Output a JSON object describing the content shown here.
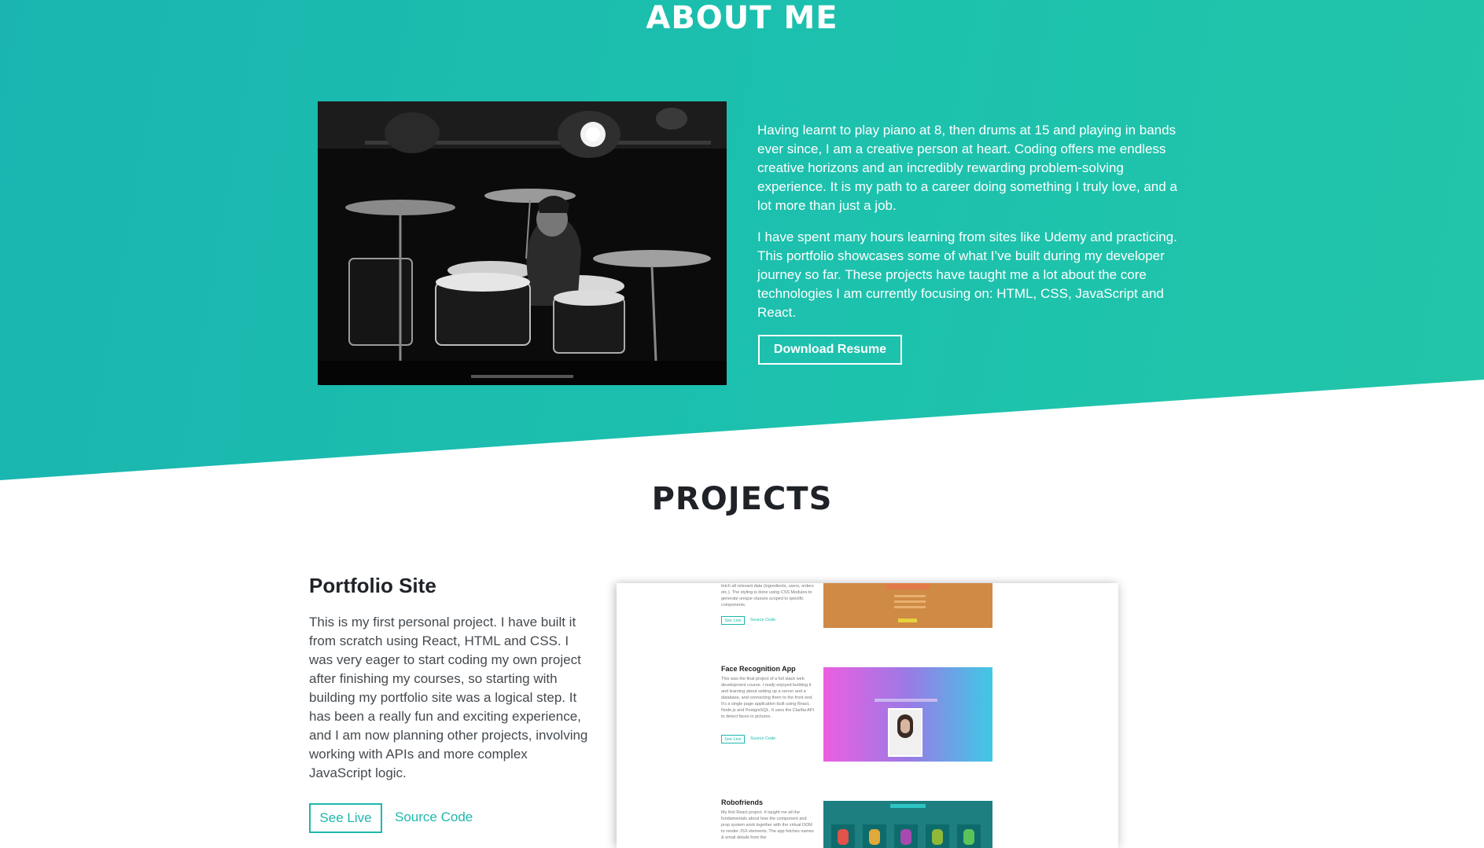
{
  "about": {
    "title": "ABOUT ME",
    "paragraphs": [
      "Having learnt to play piano at 8, then drums at 15 and playing in bands ever since, I am a creative person at heart. Coding offers me endless creative horizons and an incredibly rewarding problem-solving experience. It is my path to a career doing something I truly love, and a lot more than just a job.",
      "I have spent many hours learning from sites like Udemy and practicing. This portfolio showcases some of what I’ve built during my developer journey so far. These projects have taught me a lot about the core technologies I am currently focusing on: HTML, CSS, JavaScript and React."
    ],
    "resume_button": "Download Resume"
  },
  "projects": {
    "title": "PROJECTS",
    "items": [
      {
        "name": "Portfolio Site",
        "description": "This is my first personal project. I have built it from scratch using React, HTML and CSS. I was very eager to start coding my own project after finishing my courses, so starting with building my portfolio site was a logical step. It has been a really fun and exciting experience, and I am now planning other projects, involving working with APIs and more complex JavaScript logic.",
        "see_live": "See Live",
        "source_code": "Source Code"
      }
    ],
    "preview": {
      "item0_text": "fetch all relevant data (ingredients, users, orders etc.). The styling is done using CSS Modules to generate unique classes scoped to specific components.",
      "item1_title": "Face Recognition App",
      "item1_text": "This was the final project of a full stack web development course. I really enjoyed building it and learning about setting up a server and a database, and connecting them to the front end. It's a single page application built using React, Node.js and PostgreSQL. It uses the Clarifai API to detect faces in pictures.",
      "item2_title": "Robofriends",
      "item2_text": "My first React project. It taught me all the fundamentals about how the component and prop system work together with the virtual DOM to render JSX elements. The app fetches names & email details from the",
      "see_live": "See Live",
      "source_code": "Source Code"
    }
  },
  "colors": {
    "accent": "#1db8ad",
    "heading_dark": "#1f2328"
  },
  "icons": [
    "drummer-photo"
  ]
}
